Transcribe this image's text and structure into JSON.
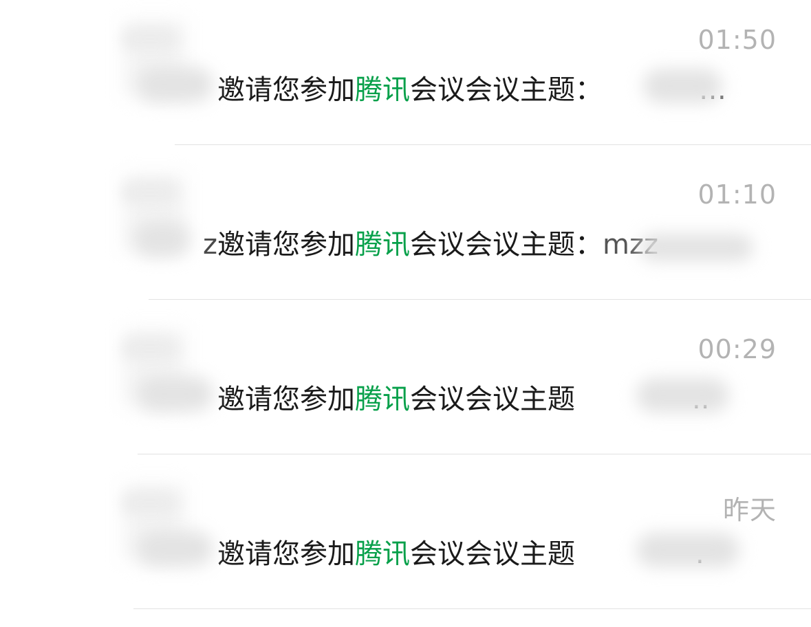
{
  "conversations": [
    {
      "time": "01:50",
      "sender_fragment": "",
      "message_prefix": "邀请您参加",
      "highlight": "腾讯",
      "message_suffix": "会议会议主题",
      "separator": "：",
      "tail": "…"
    },
    {
      "time": "01:10",
      "sender_fragment": "z",
      "message_prefix": "邀请您参加",
      "highlight": "腾讯",
      "message_suffix": "会议会议主题",
      "separator": "：",
      "tail": "mzz"
    },
    {
      "time": "00:29",
      "sender_fragment": "",
      "message_prefix": "邀请您参加",
      "highlight": "腾讯",
      "message_suffix": "会议会议主题",
      "separator": "",
      "tail": ".."
    },
    {
      "time": "昨天",
      "sender_fragment": "",
      "message_prefix": "邀请您参加",
      "highlight": "腾讯",
      "message_suffix": "会议会议主题",
      "separator": "",
      "tail": "."
    }
  ],
  "colors": {
    "highlight": "#07a04a",
    "time": "#b3b3b3",
    "text": "#1a1a1a",
    "divider": "#e2e2e2"
  }
}
